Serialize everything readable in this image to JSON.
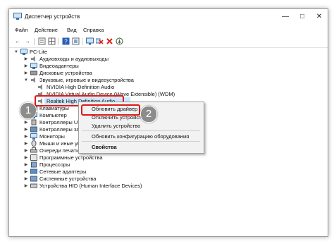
{
  "window": {
    "title": "Диспетчер устройств"
  },
  "menu": [
    "Файл",
    "Действие",
    "Вид",
    "Справка"
  ],
  "toolbar_icons": [
    "back-icon",
    "forward-icon",
    "properties-icon",
    "grid-icon",
    "help-icon",
    "scan-icon",
    "monitor-icon",
    "remove-icon",
    "update-icon"
  ],
  "tree": {
    "root": "PC-Lite",
    "items": [
      {
        "label": "Аудиовходы и аудиовыходы",
        "icon": "audio-io-icon"
      },
      {
        "label": "Видеоадаптеры",
        "icon": "display-adapter-icon"
      },
      {
        "label": "Дисковые устройства",
        "icon": "disk-icon"
      },
      {
        "label": "Звуковые, игровые и видеоустройства",
        "icon": "sound-icon"
      },
      {
        "label": "NVIDIA High Definition Audio",
        "icon": "speaker-icon"
      },
      {
        "label": "NVIDIA Virtual Audio Device (Wave Extensible) (WDM)",
        "icon": "speaker-icon"
      },
      {
        "label": "Realtek High Definition Audio",
        "icon": "speaker-icon"
      },
      {
        "label": "Клавиатуры",
        "icon": "keyboard-icon"
      },
      {
        "label": "Компьютер",
        "icon": "computer-icon"
      },
      {
        "label": "Контроллеры USB",
        "icon": "usb-icon"
      },
      {
        "label": "Контроллеры запоминающих устройств",
        "icon": "storage-icon"
      },
      {
        "label": "Мониторы",
        "icon": "monitor-icon"
      },
      {
        "label": "Мыши и иные указывающие устройства",
        "icon": "mouse-icon"
      },
      {
        "label": "Очереди печати",
        "icon": "printer-icon"
      },
      {
        "label": "Программные устройства",
        "icon": "software-icon"
      },
      {
        "label": "Процессоры",
        "icon": "cpu-icon"
      },
      {
        "label": "Сетевые адаптеры",
        "icon": "network-icon"
      },
      {
        "label": "Системные устройства",
        "icon": "system-icon"
      },
      {
        "label": "Устройства HID (Human Interface Devices)",
        "icon": "hid-icon"
      }
    ]
  },
  "context_menu": {
    "items": [
      "Обновить драйвер",
      "Отключить устройство",
      "Удалить устройство",
      "Обновить конфигурацию оборудования",
      "Свойства"
    ]
  },
  "badges": [
    "1",
    "2"
  ],
  "colors": {
    "highlight": "#e01818",
    "selection": "#cce8ff",
    "badge": "#8c8c8c"
  }
}
